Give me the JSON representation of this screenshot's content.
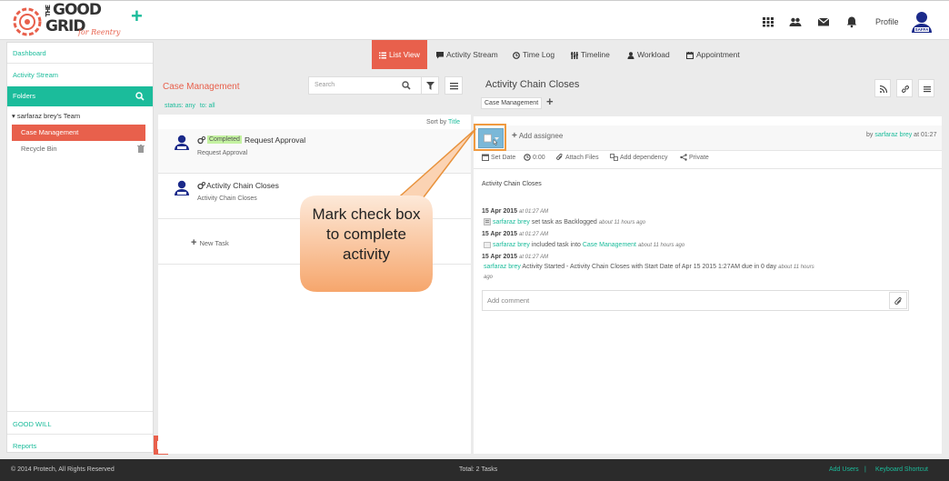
{
  "brand": {
    "line1": "THE",
    "line2": "GOOD",
    "line3": "GRID",
    "tagline": "for Reentry"
  },
  "header": {
    "profile_label": "Profile",
    "avatar_badge": "SAFFA"
  },
  "sidebar": {
    "dashboard": "Dashboard",
    "activity_stream": "Activity Stream",
    "folders": "Folders",
    "team": "sarfaraz brey's Team",
    "case_management": "Case Management",
    "recycle_bin": "Recycle Bin",
    "good_will": "GOOD WILL",
    "reports": "Reports"
  },
  "tabs": {
    "list_view": "List View",
    "activity_stream": "Activity Stream",
    "time_log": "Time Log",
    "timeline": "Timeline",
    "workload": "Workload",
    "appointment": "Appointment"
  },
  "list": {
    "title": "Case Management",
    "status_filter": "status: any",
    "to_filter": "to: all",
    "search_placeholder": "Search",
    "sort_label": "Sort by",
    "sort_value": "Title",
    "tasks": [
      {
        "badge": "Completed",
        "title": "Request Approval",
        "subtitle": "Request Approval"
      },
      {
        "title": "Activity Chain Closes",
        "subtitle": "Activity Chain Closes"
      }
    ],
    "new_task": "New Task"
  },
  "detail": {
    "title": "Activity Chain Closes",
    "tag": "Case Management",
    "add_assignee": "Add assignee",
    "by_prefix": "by",
    "by_user": "sarfaraz brey",
    "by_time": "at 01:27",
    "actions": {
      "set_date": "Set Date",
      "time": "0:00",
      "attach": "Attach Files",
      "dependency": "Add dependency",
      "private": "Private"
    },
    "description": "Activity Chain Closes",
    "log": [
      {
        "date": "15 Apr 2015",
        "time": "at 01:27 AM",
        "user": "sarfaraz brey",
        "text": "set task as Backlogged",
        "ago": "about 11 hours ago"
      },
      {
        "date": "15 Apr 2015",
        "time": "at 01:27 AM",
        "user": "sarfaraz brey",
        "text": "included task into",
        "link": "Case Management",
        "ago": "about 11 hours ago"
      },
      {
        "date": "15 Apr 2015",
        "time": "at 01:27 AM",
        "user": "sarfaraz brey",
        "text": "Activity Started - Activity Chain Closes with Start Date of Apr 15 2015 1:27AM due in 0 day",
        "ago": "about 11 hours",
        "ago2": "ago"
      }
    ],
    "comment_placeholder": "Add comment"
  },
  "callout": {
    "text": "Mark check box to complete activity"
  },
  "footer": {
    "copyright": "© 2014 Protech, All Rights Reserved",
    "total": "Total: 2 Tasks",
    "add_users": "Add Users",
    "separator": "|",
    "shortcut": "Keyboard Shortcut"
  },
  "colors": {
    "accent": "#1bbc9b",
    "brand": "#e8604c",
    "callout": "#f7a66c"
  }
}
